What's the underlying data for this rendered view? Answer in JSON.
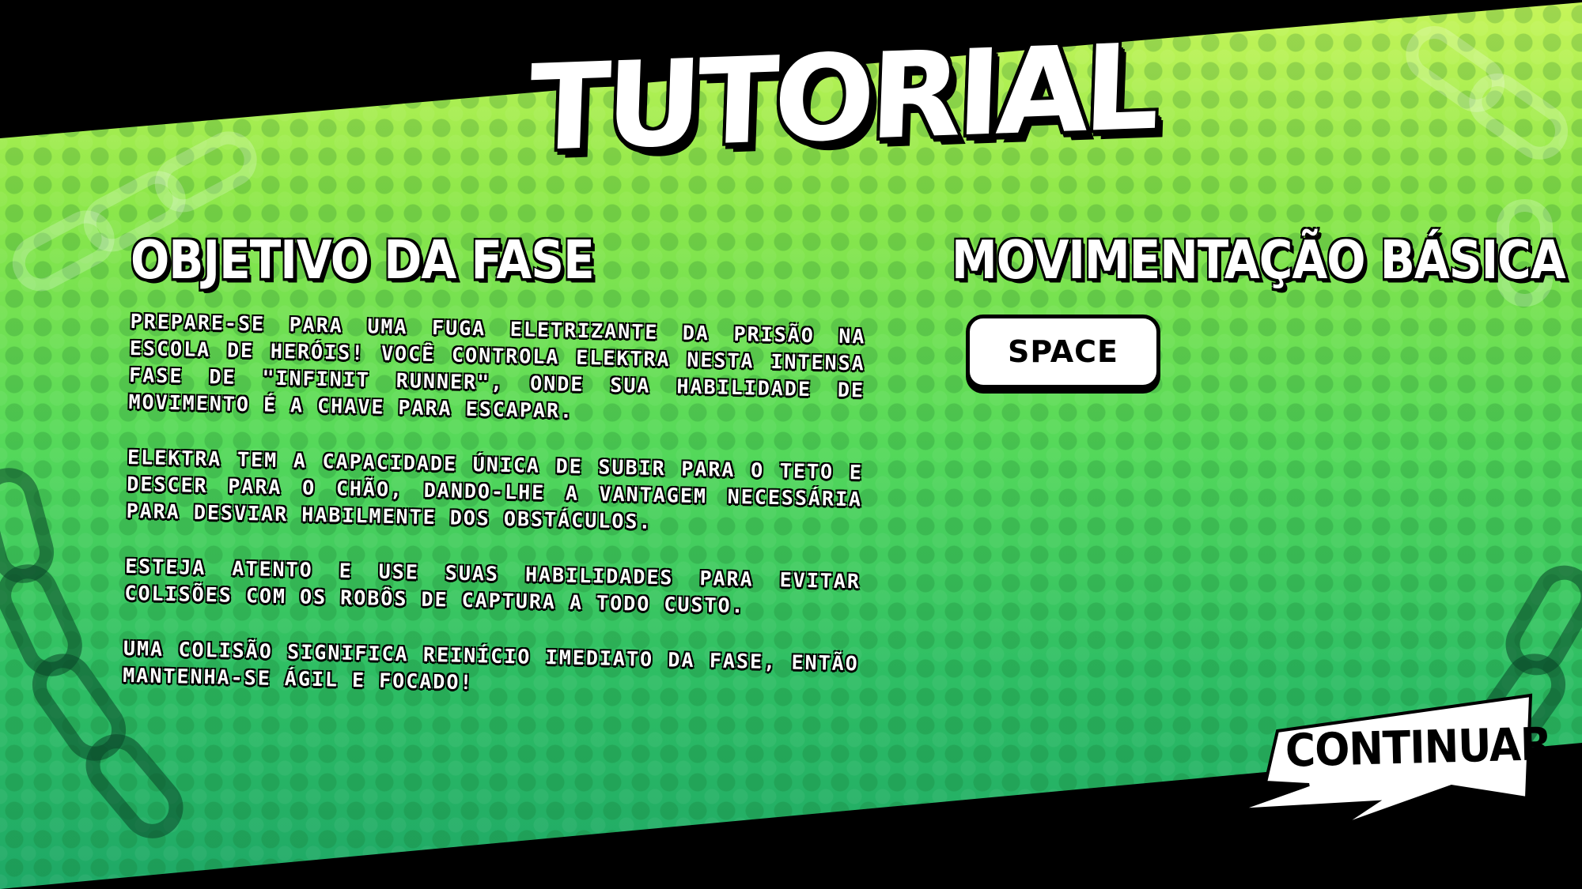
{
  "screen": {
    "title": "TUTORIAL",
    "colors": {
      "panel_top": "#c7f55a",
      "panel_bottom": "#1ea866",
      "background": "#000000",
      "text": "#ffffff"
    }
  },
  "objective": {
    "heading": "OBJETIVO DA FASE",
    "paragraphs": [
      "PREPARE-SE PARA UMA FUGA ELETRIZANTE DA PRISÃO NA ESCOLA DE HERÓIS! VOCÊ CONTROLA ELEKTRA NESTA INTENSA FASE DE \"INFINIT RUNNER\", ONDE SUA HABILIDADE DE MOVIMENTO É A CHAVE PARA ESCAPAR.",
      "ELEKTRA TEM A CAPACIDADE ÚNICA DE SUBIR PARA O TETO E DESCER PARA O CHÃO, DANDO-LHE A VANTAGEM NECESSÁRIA PARA DESVIAR HABILMENTE DOS OBSTÁCULOS.",
      "ESTEJA ATENTO E USE SUAS HABILIDADES PARA EVITAR COLISÕES COM OS ROBÔS DE CAPTURA A TODO CUSTO.",
      "UMA COLISÃO SIGNIFICA REINÍCIO IMEDIATO DA FASE, ENTÃO MANTENHA-SE ÁGIL E FOCADO!"
    ]
  },
  "movement": {
    "heading": "MOVIMENTAÇÃO BÁSICA",
    "key_label": "SPACE"
  },
  "actions": {
    "continue_label": "CONTINUAR"
  }
}
